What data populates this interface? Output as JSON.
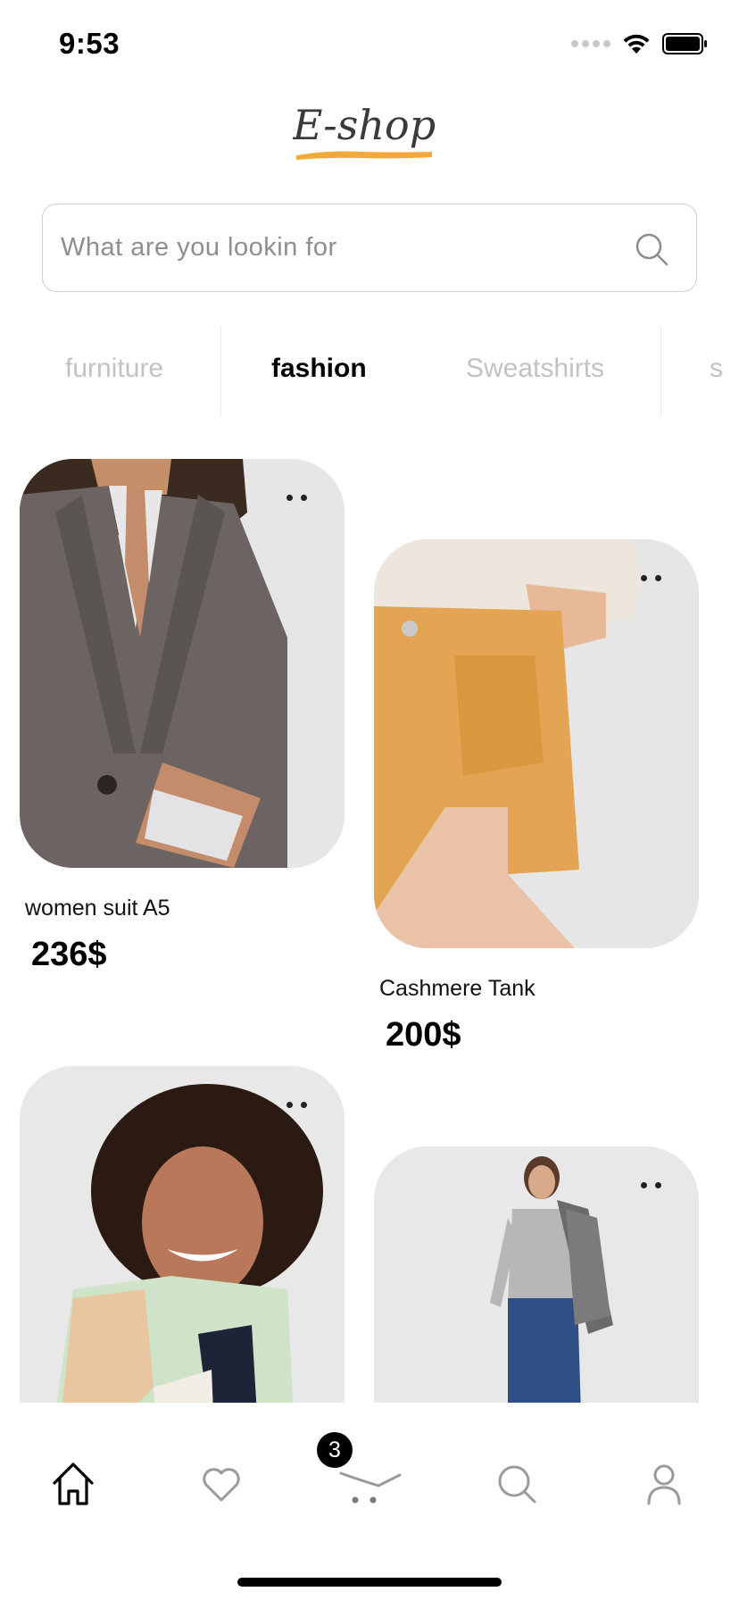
{
  "status_bar": {
    "time": "9:53"
  },
  "app": {
    "logo_text": "E-shop"
  },
  "search": {
    "placeholder": "What are you lookin for"
  },
  "categories": [
    {
      "label": "furniture",
      "active": false
    },
    {
      "label": "fashion",
      "active": true
    },
    {
      "label": "Sweatshirts",
      "active": false
    },
    {
      "label": "s",
      "active": false
    }
  ],
  "products": [
    {
      "name": "women suit A5",
      "price": "236$"
    },
    {
      "name": "Cashmere Tank",
      "price": "200$"
    },
    {
      "name": "",
      "price": ""
    },
    {
      "name": "",
      "price": ""
    }
  ],
  "cart": {
    "count": "3"
  },
  "nav": [
    "home-icon",
    "heart-icon",
    "cart-icon",
    "search-icon",
    "user-icon"
  ],
  "colors": {
    "accent": "#f2a93b",
    "card_bg": "#e8e8e9",
    "active_text": "#000000",
    "inactive_text": "#c2c2c2"
  }
}
